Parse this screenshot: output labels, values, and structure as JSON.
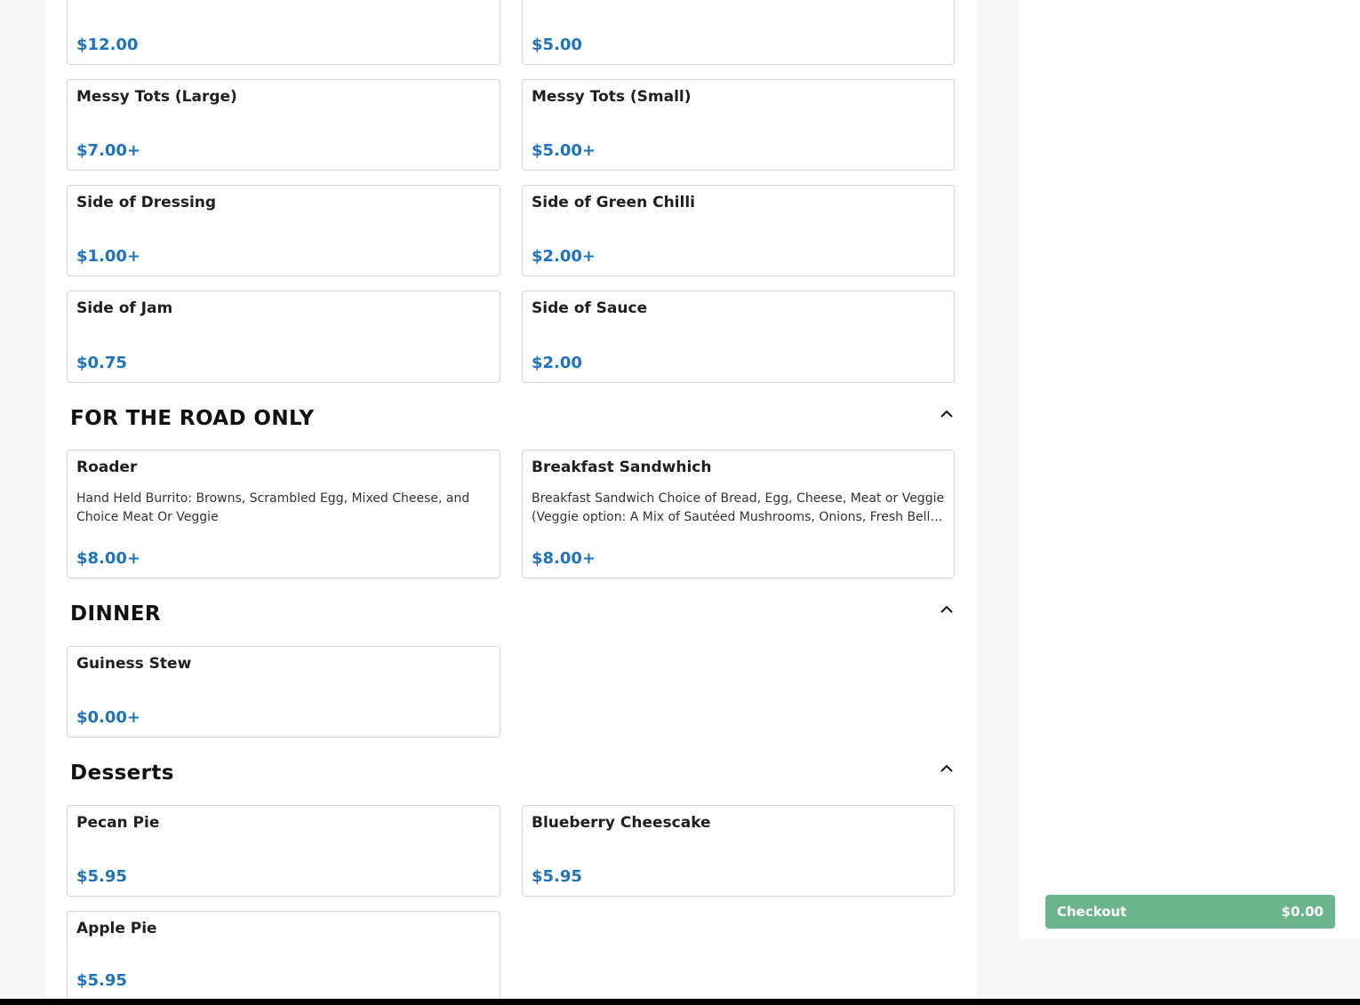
{
  "sections": {
    "sides": {
      "items": [
        {
          "name": "",
          "price": "$12.00"
        },
        {
          "name": "",
          "price": "$5.00"
        },
        {
          "name": "Messy Tots (Large)",
          "price": "$7.00+"
        },
        {
          "name": "Messy Tots (Small)",
          "price": "$5.00+"
        },
        {
          "name": "Side of Dressing",
          "price": "$1.00+"
        },
        {
          "name": "Side of Green Chilli",
          "price": "$2.00+"
        },
        {
          "name": "Side of Jam",
          "price": "$0.75"
        },
        {
          "name": "Side of Sauce",
          "price": "$2.00"
        }
      ]
    },
    "road": {
      "title": "FOR THE ROAD ONLY",
      "items": [
        {
          "name": "Roader",
          "description": "Hand Held Burrito: Browns, Scrambled Egg, Mixed Cheese, and Choice Meat Or Veggie",
          "price": "$8.00+"
        },
        {
          "name": "Breakfast Sandwhich",
          "description": "Breakfast Sandwich Choice of Bread, Egg, Cheese, Meat or Veggie (Veggie option: A Mix of Sautéed Mushrooms, Onions, Fresh Bell Peppers)",
          "price": "$8.00+"
        }
      ]
    },
    "dinner": {
      "title": "DINNER",
      "items": [
        {
          "name": "Guiness Stew",
          "price": "$0.00+"
        }
      ]
    },
    "desserts": {
      "title": "Desserts",
      "items": [
        {
          "name": "Pecan Pie",
          "price": "$5.95"
        },
        {
          "name": "Blueberry Cheescake",
          "price": "$5.95"
        },
        {
          "name": "Apple Pie",
          "price": "$5.95"
        }
      ]
    }
  },
  "cart": {
    "checkout_label": "Checkout",
    "total": "$0.00"
  },
  "icons": {
    "collapse": "chevron-up-icon"
  },
  "colors": {
    "price": "#1e73be",
    "checkout": "#6cb48c"
  }
}
